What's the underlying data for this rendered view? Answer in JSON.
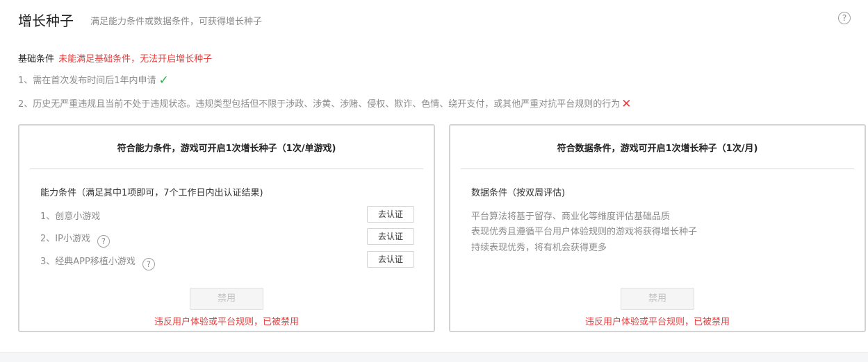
{
  "header": {
    "title": "增长种子",
    "subtitle": "满足能力条件或数据条件，可获得增长种子",
    "help_icon": "?"
  },
  "basic": {
    "label": "基础条件",
    "warning": "未能满足基础条件，无法开启增长种子",
    "requirements": [
      {
        "text": "1、需在首次发布时间后1年内申请",
        "status": "met",
        "icon": "✓"
      },
      {
        "text": "2、历史无严重违规且当前不处于违规状态。违规类型包括但不限于涉政、涉黄、涉赌、侵权、欺诈、色情、绕开支付，或其他严重对抗平台规则的行为",
        "status": "not-met",
        "icon": "✕"
      }
    ]
  },
  "ability_card": {
    "title": "符合能力条件，游戏可开启1次增长种子（1次/单游戏)",
    "section_title": "能力条件（满足其中1项即可，7个工作日内出认证结果)",
    "conditions": [
      {
        "label": "1、创意小游戏",
        "button": "去认证"
      },
      {
        "label": "2、IP小游戏",
        "button": "去认证",
        "help": "?"
      },
      {
        "label": "3、经典APP移植小游戏",
        "button": "去认证",
        "help": "?"
      }
    ],
    "action_button": "禁用",
    "ban_text": "违反用户体验或平台规则，已被禁用"
  },
  "data_card": {
    "title": "符合数据条件，游戏可开启1次增长种子（1次/月)",
    "section_title": "数据条件（按双周评估)",
    "lines": [
      "平台算法将基于留存、商业化等维度评估基础品质",
      "表现优秀且遵循平台用户体验规则的游戏将获得增长种子",
      "持续表现优秀，将有机会获得更多"
    ],
    "action_button": "禁用",
    "ban_text": "违反用户体验或平台规则，已被禁用"
  },
  "colors": {
    "warning": "#e83c3c",
    "success": "#2bb24c",
    "muted_text": "#8c8c8c",
    "border": "#d4d4d4"
  }
}
